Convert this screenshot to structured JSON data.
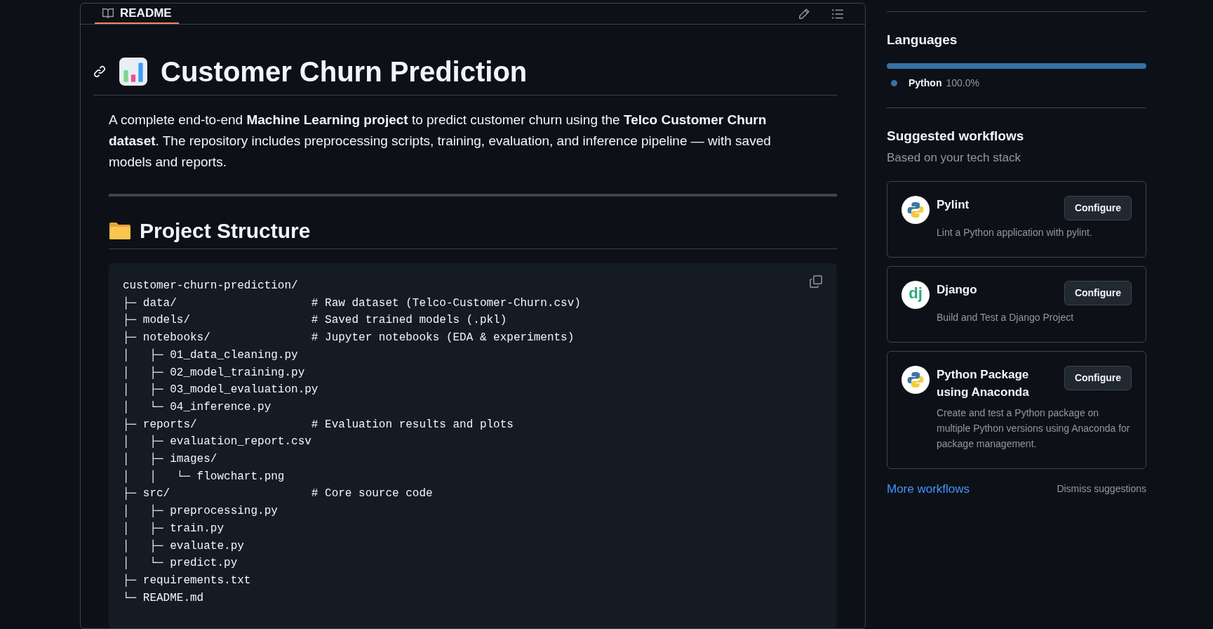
{
  "readme": {
    "tab": {
      "label": "README",
      "selected": true
    },
    "title": "Customer Churn Prediction",
    "intro": "A complete end-to-end **Machine Learning project** to predict customer churn using the **Telco Customer Churn dataset**. The repository includes preprocessing scripts, training, evaluation, and inference pipeline — with saved models and reports.",
    "section_title": "Project Structure",
    "code_lines": [
      "customer-churn-prediction/",
      "├─ data/                    # Raw dataset (Telco-Customer-Churn.csv)",
      "├─ models/                  # Saved trained models (.pkl)",
      "├─ notebooks/               # Jupyter notebooks (EDA & experiments)",
      "│   ├─ 01_data_cleaning.py",
      "│   ├─ 02_model_training.py",
      "│   ├─ 03_model_evaluation.py",
      "│   └─ 04_inference.py",
      "├─ reports/                 # Evaluation results and plots",
      "│   ├─ evaluation_report.csv",
      "│   ├─ images/",
      "│   │   └─ flowchart.png",
      "├─ src/                     # Core source code",
      "│   ├─ preprocessing.py",
      "│   ├─ train.py",
      "│   ├─ evaluate.py",
      "│   └─ predict.py",
      "├─ requirements.txt",
      "└─ README.md"
    ]
  },
  "sidebar": {
    "languages": {
      "title": "Languages",
      "items": [
        {
          "name": "Python",
          "percent": "100.0%",
          "level": 1.0,
          "color": "#3572a5"
        }
      ]
    },
    "workflows": {
      "title": "Suggested workflows",
      "subtitle": "Based on your tech stack",
      "items": [
        {
          "kind": "python",
          "name": "Pylint",
          "description": "Lint a Python application with pylint.",
          "button": "Configure"
        },
        {
          "kind": "django",
          "logo_text": "dj",
          "name": "Django",
          "description": "Build and Test a Django Project",
          "button": "Configure"
        },
        {
          "kind": "python",
          "name": "Python Package using Anaconda",
          "description": "Create and test a Python package on multiple Python versions using Anaconda for package management.",
          "button": "Configure"
        }
      ],
      "more_link": "More workflows",
      "dismiss": "Dismiss suggestions"
    }
  }
}
